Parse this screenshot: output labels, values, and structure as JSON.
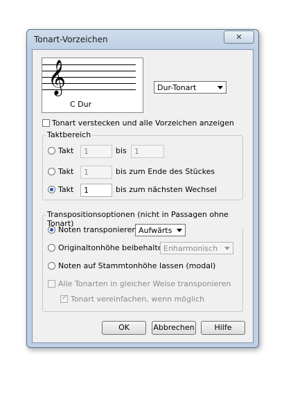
{
  "dialog": {
    "title": "Tonart-Vorzeichen",
    "close_label": "✕"
  },
  "preview": {
    "key_name": "C Dur",
    "clef_glyph": "𝄞"
  },
  "key_type": {
    "selected": "Dur-Tonart"
  },
  "hide_key": {
    "label": "Tonart verstecken und alle Vorzeichen anzeigen",
    "checked": false
  },
  "measure_range": {
    "title": "Taktbereich",
    "rows": [
      {
        "label": "Takt",
        "from": "1",
        "mid": "bis",
        "to": "1",
        "selected": false
      },
      {
        "label": "Takt",
        "from": "1",
        "suffix": "bis zum Ende des Stückes",
        "selected": false
      },
      {
        "label": "Takt",
        "from": "1",
        "suffix": "bis zum nächsten Wechsel",
        "selected": true
      }
    ]
  },
  "transposition": {
    "title": "Transpositionsoptionen (nicht in Passagen ohne Tonart)",
    "transpose_label": "Noten transponieren",
    "direction": "Aufwärts",
    "keep_pitch_label": "Originaltonhöhe beibehalten",
    "enharmonic": "Enharmonisch",
    "modal_label": "Noten auf Stammtonhöhe lassen (modal)",
    "all_keys_label": "Alle Tonarten in gleicher Weise transponieren",
    "simplify_label": "Tonart vereinfachen, wenn möglich"
  },
  "buttons": {
    "ok": "OK",
    "cancel": "Abbrechen",
    "help": "Hilfe"
  },
  "colors": {
    "selection": "#1f5db8",
    "frame": "#bfd0e6"
  }
}
